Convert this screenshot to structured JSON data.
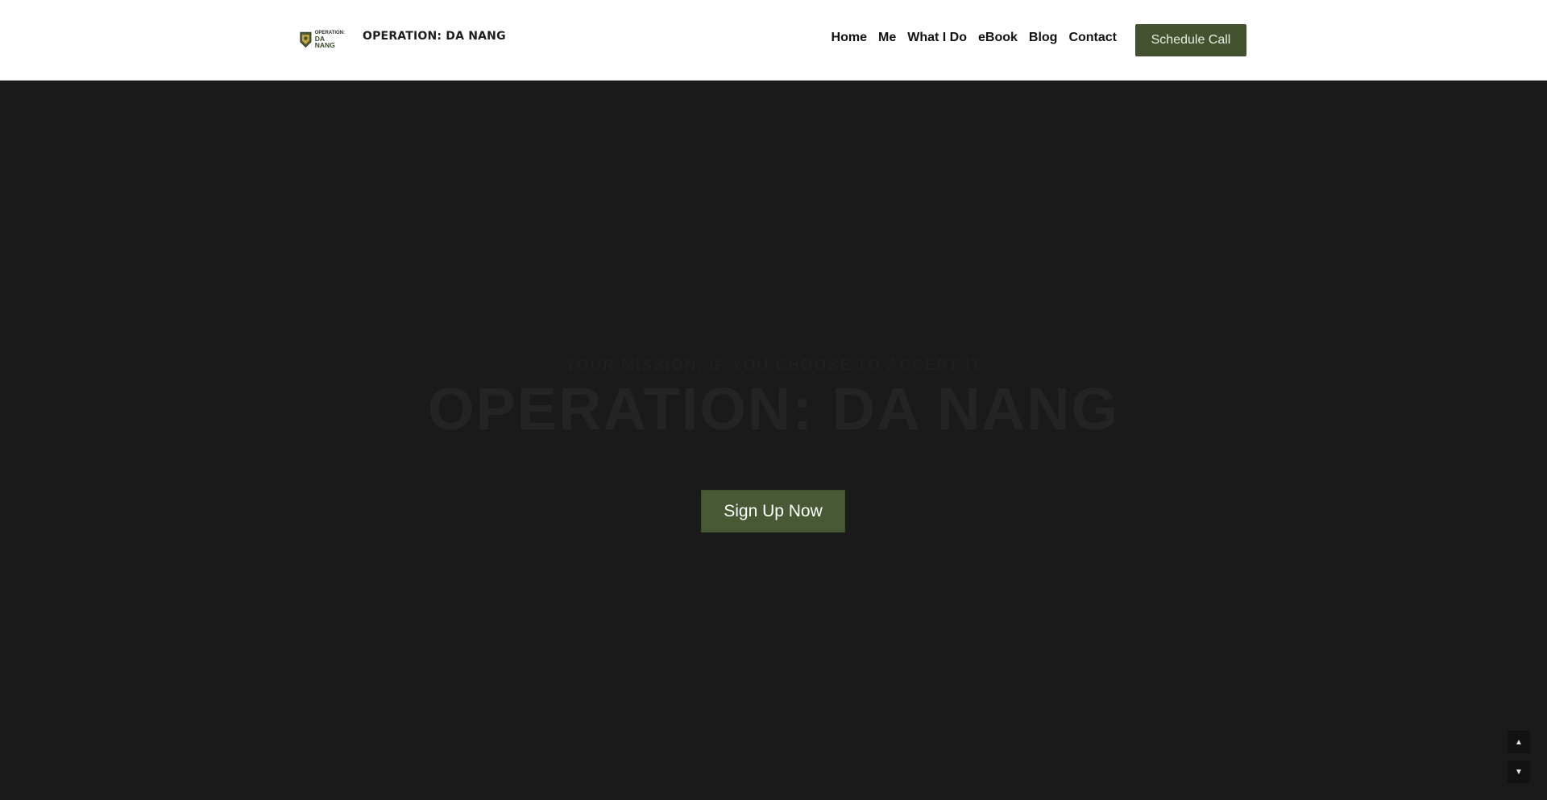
{
  "header": {
    "logo_top": "OPERATION:",
    "logo_bottom": "DA NANG",
    "brand_name": "OPERATION: DA NANG",
    "nav": [
      {
        "label": "Home"
      },
      {
        "label": "Me"
      },
      {
        "label": "What I Do"
      },
      {
        "label": "eBook"
      },
      {
        "label": "Blog"
      },
      {
        "label": "Contact"
      }
    ],
    "cta_label": "Schedule Call"
  },
  "hero": {
    "kicker": "YOUR MISSION, IF YOU CHOOSE TO ACCEPT IT",
    "headline": "OPERATION: DA NANG",
    "signup_label": "Sign Up Now"
  },
  "scroll": {
    "up_icon": "triangle-up-icon",
    "down_icon": "triangle-down-icon"
  },
  "colors": {
    "accent_green": "#44522f",
    "hero_bg": "#1a1a1a"
  }
}
